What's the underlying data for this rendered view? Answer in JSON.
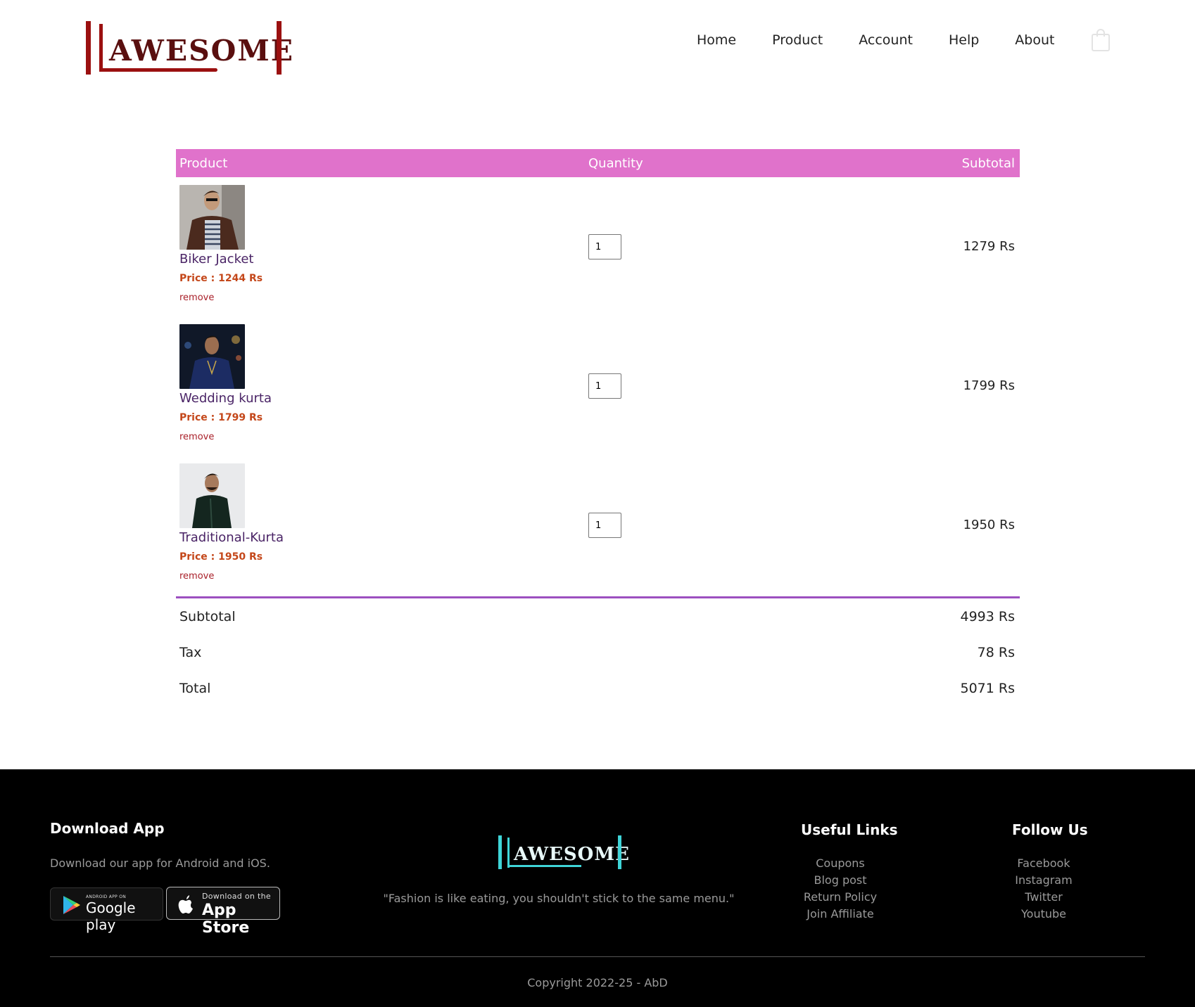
{
  "brand": {
    "name": "AWESOME",
    "color": "#9b1010",
    "footer_color": "#3fd5d8"
  },
  "nav": {
    "items": [
      "Home",
      "Product",
      "Account",
      "Help",
      "About"
    ],
    "cart_icon": "shopping-bag-icon"
  },
  "cart": {
    "columns": {
      "product": "Product",
      "quantity": "Quantity",
      "subtotal": "Subtotal"
    },
    "header_color": "#e072cb",
    "items": [
      {
        "name": "Biker Jacket",
        "price": "Price : 1244 Rs",
        "remove": "remove",
        "qty": "1",
        "subtotal": "1279 Rs"
      },
      {
        "name": "Wedding kurta",
        "price": "Price : 1799 Rs",
        "remove": "remove",
        "qty": "1",
        "subtotal": "1799 Rs"
      },
      {
        "name": "Traditional-Kurta",
        "price": "Price : 1950 Rs",
        "remove": "remove",
        "qty": "1",
        "subtotal": "1950 Rs"
      }
    ],
    "totals": {
      "subtotal_label": "Subtotal",
      "subtotal": "4993 Rs",
      "tax_label": "Tax",
      "tax": "78 Rs",
      "total_label": "Total",
      "total": "5071 Rs"
    }
  },
  "footer": {
    "download": {
      "title": "Download App",
      "text": "Download our app for Android and iOS.",
      "google_small": "ANDROID APP ON",
      "google_big": "Google play",
      "apple_small": "Download on the",
      "apple_big": "App Store"
    },
    "tagline": "\"Fashion is like eating, you shouldn't stick to the same menu.\"",
    "useful_links": {
      "title": "Useful Links",
      "items": [
        "Coupons",
        "Blog post",
        "Return Policy",
        "Join Affiliate"
      ]
    },
    "follow": {
      "title": "Follow Us",
      "items": [
        "Facebook",
        "Instagram",
        "Twitter",
        "Youtube"
      ]
    },
    "copyright": "Copyright 2022-25 - AbD"
  }
}
